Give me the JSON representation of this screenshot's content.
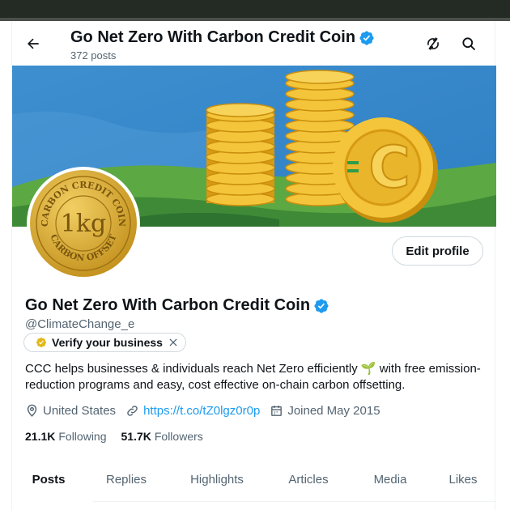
{
  "colors": {
    "accent": "#1d9bf0",
    "text": "#0f1419",
    "muted": "#536471",
    "verified": "#1d9bf0",
    "gold": "#e9b52a"
  },
  "header": {
    "title": "Go Net Zero With Carbon Credit Coin",
    "posts_count": "372 posts",
    "icons": [
      "back-arrow-icon",
      "sync-off-icon",
      "search-icon"
    ]
  },
  "banner": {
    "coin_letter": "C"
  },
  "avatar": {
    "ring_text_top": "CARBON CREDIT COIN",
    "center_text": "1kg",
    "ring_text_bottom": "CARBON OFFSET"
  },
  "profile": {
    "edit_label": "Edit profile",
    "name": "Go Net Zero With Carbon Credit Coin",
    "handle": "@ClimateChange_e",
    "verify_label": "Verify your business",
    "bio": "CCC helps businesses & individuals reach Net Zero efficiently 🌱 with free emission-reduction programs and easy, cost effective on-chain carbon offsetting.",
    "location": "United States",
    "link": "https://t.co/tZ0lgz0r0p",
    "joined": "Joined May 2015",
    "following_count": "21.1K",
    "following_label": "Following",
    "followers_count": "51.7K",
    "followers_label": "Followers"
  },
  "tabs": [
    {
      "label": "Posts",
      "active": true
    },
    {
      "label": "Replies",
      "active": false
    },
    {
      "label": "Highlights",
      "active": false
    },
    {
      "label": "Articles",
      "active": false
    },
    {
      "label": "Media",
      "active": false
    },
    {
      "label": "Likes",
      "active": false
    }
  ]
}
